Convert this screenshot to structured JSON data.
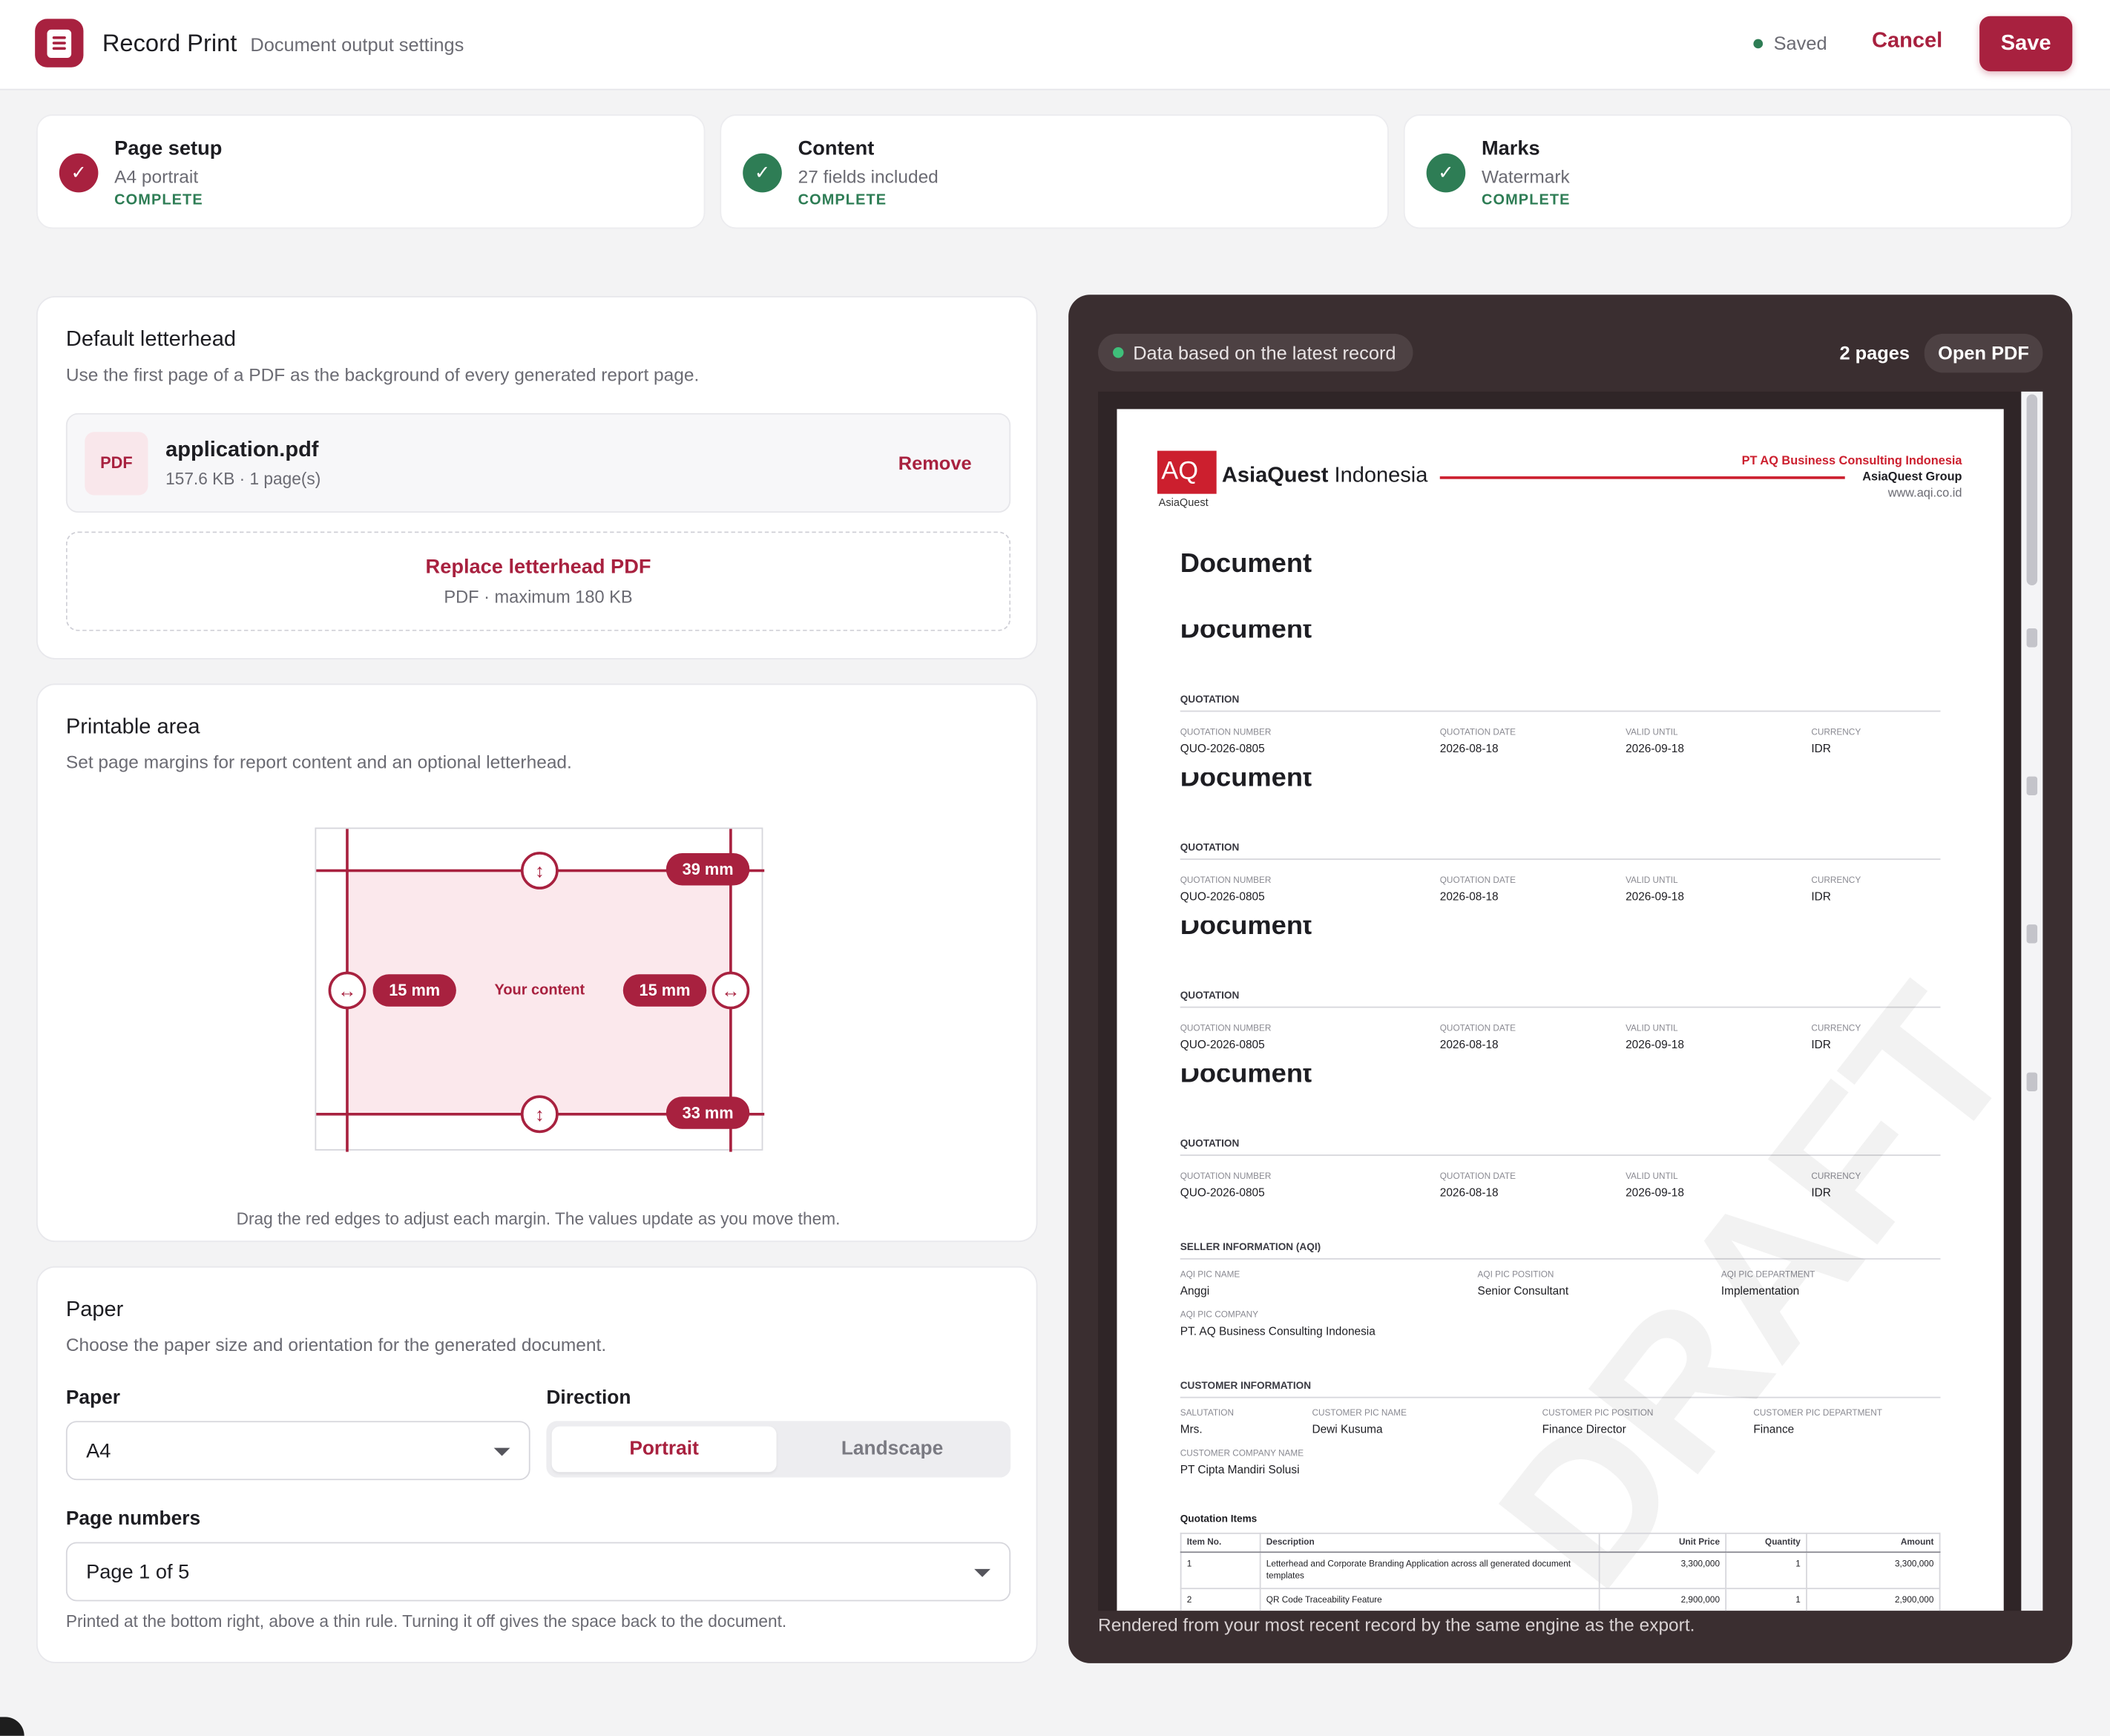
{
  "header": {
    "app_title": "Record Print",
    "app_subtitle": "Document output settings",
    "saved_label": "Saved",
    "cancel_label": "Cancel",
    "save_label": "Save"
  },
  "steps": [
    {
      "title": "Page setup",
      "summary": "A4 portrait",
      "status": "COMPLETE",
      "color": "#a8213f"
    },
    {
      "title": "Content",
      "summary": "27 fields included",
      "status": "COMPLETE",
      "color": "#2e7d55"
    },
    {
      "title": "Marks",
      "summary": "Watermark",
      "status": "COMPLETE",
      "color": "#2e7d55"
    }
  ],
  "letterhead": {
    "title": "Default letterhead",
    "subtitle": "Use the first page of a PDF as the background of every generated report page.",
    "file_badge": "PDF",
    "file_name": "application.pdf",
    "file_meta": "157.6 KB · 1 page(s)",
    "remove_label": "Remove",
    "replace_label": "Replace letterhead PDF",
    "replace_hint": "PDF · maximum 180 KB"
  },
  "printable": {
    "title": "Printable area",
    "subtitle": "Set page margins for report content and an optional letterhead.",
    "top": "39 mm",
    "bottom": "33 mm",
    "left": "15 mm",
    "right": "15 mm",
    "content_label": "Your content",
    "hint": "Drag the red edges to adjust each margin. The values update as you move them."
  },
  "paper": {
    "title": "Paper",
    "subtitle": "Choose the paper size and orientation for the generated document.",
    "paper_label": "Paper",
    "paper_value": "A4",
    "direction_label": "Direction",
    "portrait_label": "Portrait",
    "landscape_label": "Landscape",
    "page_numbers_label": "Page numbers",
    "page_numbers_value": "Page 1 of 5",
    "page_numbers_note": "Printed at the bottom right, above a thin rule. Turning it off gives the space back to the document."
  },
  "preview": {
    "chip": "Data based on the latest record",
    "pages": "2 pages",
    "open_pdf": "Open PDF",
    "footer": "Rendered from your most recent record by the same engine as the export.",
    "doc": {
      "logo_text": "AQ",
      "logo_sub": "AsiaQuest",
      "brand_bold": "AsiaQuest",
      "brand_rest": " Indonesia",
      "company": "PT AQ Business Consulting Indonesia",
      "group": "AsiaQuest Group",
      "website": "www.aqi.co.id",
      "title": "Document",
      "ghost_title": "Document",
      "quotation_section": "QUOTATION",
      "q_labels": [
        "QUOTATION NUMBER",
        "QUOTATION DATE",
        "VALID UNTIL",
        "CURRENCY"
      ],
      "q_values": [
        "QUO-2026-0805",
        "2026-08-18",
        "2026-09-18",
        "IDR"
      ],
      "seller_section": "SELLER INFORMATION (AQI)",
      "seller_labels": [
        "AQI PIC NAME",
        "AQI PIC POSITION",
        "AQI PIC DEPARTMENT",
        "AQI PIC COMPANY"
      ],
      "seller_values": [
        "Anggi",
        "Senior Consultant",
        "Implementation",
        "PT. AQ Business Consulting Indonesia"
      ],
      "customer_section": "CUSTOMER INFORMATION",
      "customer_labels": [
        "SALUTATION",
        "CUSTOMER PIC NAME",
        "CUSTOMER PIC POSITION",
        "CUSTOMER PIC DEPARTMENT",
        "CUSTOMER COMPANY NAME"
      ],
      "customer_values": [
        "Mrs.",
        "Dewi Kusuma",
        "Finance Director",
        "Finance",
        "PT Cipta Mandiri Solusi"
      ],
      "items_title": "Quotation Items",
      "items_headers": [
        "Item No.",
        "Description",
        "Unit Price",
        "Quantity",
        "Amount"
      ],
      "items": [
        [
          "1",
          "Letterhead and Corporate Branding Application across all generated document templates",
          "3,300,000",
          "1",
          "3,300,000"
        ],
        [
          "2",
          "QR Code Traceability Feature",
          "2,900,000",
          "1",
          "2,900,000"
        ]
      ],
      "watermark": "DRAFT"
    }
  }
}
